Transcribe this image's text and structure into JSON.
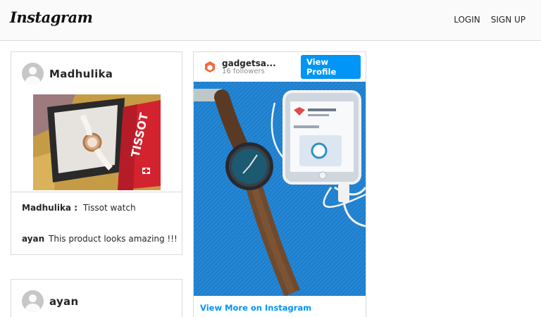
{
  "header": {
    "logo_text": "Instagram",
    "nav": {
      "login": "LOGIN",
      "signup": "SIGN UP"
    }
  },
  "posts": [
    {
      "username": "Madhulika",
      "caption_user": "Madhulika :",
      "caption_text": "Tissot watch",
      "comment_user": "ayan",
      "comment_text": "This product looks amazing !!!",
      "image_icon": "watch-box-photo"
    },
    {
      "username": "ayan"
    }
  ],
  "embed": {
    "account_name": "gadgetsa...",
    "followers": "16 followers",
    "view_profile_label": "View Profile",
    "view_more_label": "View More on Instagram",
    "image_icon": "smartwatch-phone-photo"
  },
  "colors": {
    "accent": "#0095f6",
    "brand_logo": "#f26a3d"
  }
}
